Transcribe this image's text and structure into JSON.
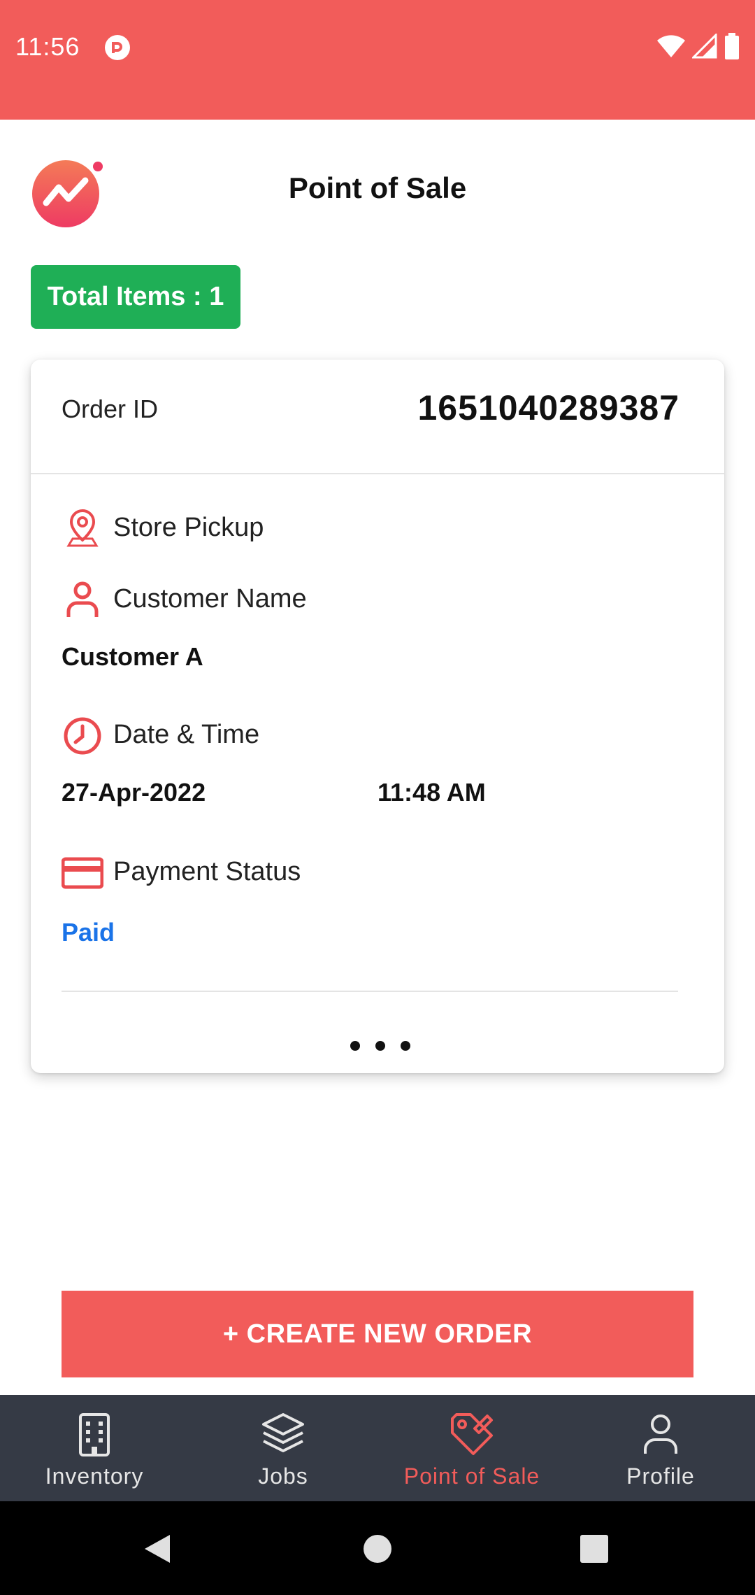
{
  "status_bar": {
    "time": "11:56",
    "bg_color": "#f25c5a"
  },
  "header": {
    "title": "Point of Sale",
    "logo_icon": "trend-logo-icon"
  },
  "summary": {
    "total_items_label": "Total Items : 1",
    "badge_color": "#1faf56"
  },
  "order": {
    "id_label": "Order ID",
    "id_value": "1651040289387",
    "pickup_label": "Store Pickup",
    "customer_label": "Customer Name",
    "customer_value": "Customer A",
    "datetime_label": "Date & Time",
    "date_value": "27-Apr-2022",
    "time_value": "11:48 AM",
    "payment_label": "Payment Status",
    "payment_value": "Paid",
    "payment_color": "#1a73e8"
  },
  "actions": {
    "create_order_label": "+ CREATE NEW ORDER"
  },
  "bottom_nav": {
    "items": [
      {
        "label": "Inventory",
        "icon": "building-icon",
        "active": false
      },
      {
        "label": "Jobs",
        "icon": "layers-icon",
        "active": false
      },
      {
        "label": "Point of Sale",
        "icon": "tag-icon",
        "active": true
      },
      {
        "label": "Profile",
        "icon": "person-icon",
        "active": false
      }
    ],
    "active_color": "#f25c5a"
  }
}
